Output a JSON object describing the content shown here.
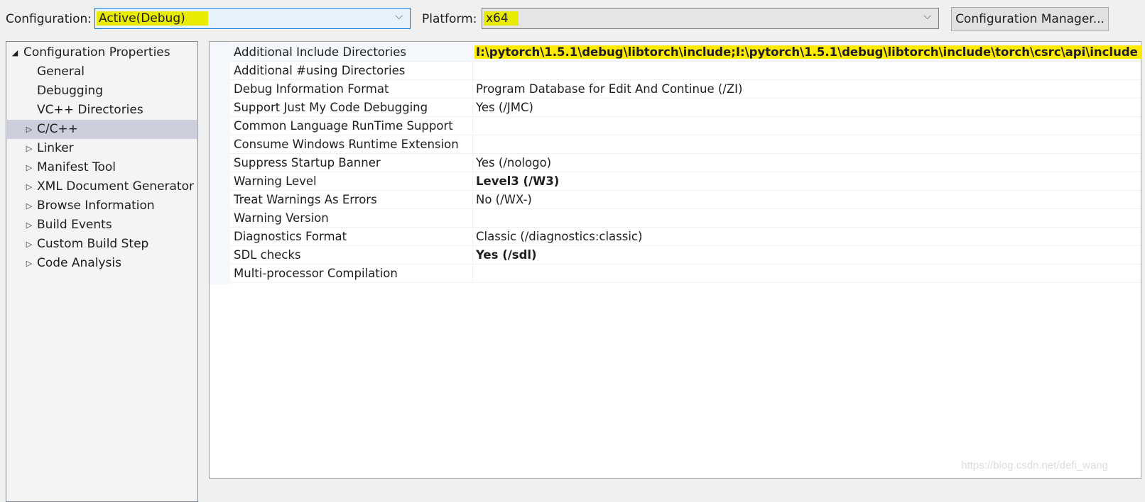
{
  "header": {
    "configuration_label": "Configuration:",
    "configuration_value": "Active(Debug)",
    "platform_label": "Platform:",
    "platform_value": "x64",
    "config_manager_button": "Configuration Manager...",
    "chevron_glyph": "⌵"
  },
  "tree": {
    "root": {
      "label": "Configuration Properties",
      "expanded": true,
      "arrow": "◢"
    },
    "items": [
      {
        "label": "General",
        "expandable": false
      },
      {
        "label": "Debugging",
        "expandable": false
      },
      {
        "label": "VC++ Directories",
        "expandable": false
      },
      {
        "label": "C/C++",
        "expandable": true,
        "selected": true
      },
      {
        "label": "Linker",
        "expandable": true
      },
      {
        "label": "Manifest Tool",
        "expandable": true
      },
      {
        "label": "XML Document Generator",
        "expandable": true
      },
      {
        "label": "Browse Information",
        "expandable": true
      },
      {
        "label": "Build Events",
        "expandable": true
      },
      {
        "label": "Custom Build Step",
        "expandable": true
      },
      {
        "label": "Code Analysis",
        "expandable": true
      }
    ],
    "collapsed_arrow": "▷"
  },
  "properties": [
    {
      "name": "Additional Include Directories",
      "value": "I:\\pytorch\\1.5.1\\debug\\libtorch\\include;I:\\pytorch\\1.5.1\\debug\\libtorch\\include\\torch\\csrc\\api\\include",
      "bold": true,
      "highlighted": true,
      "selected": true
    },
    {
      "name": "Additional #using Directories",
      "value": ""
    },
    {
      "name": "Debug Information Format",
      "value": "Program Database for Edit And Continue (/ZI)"
    },
    {
      "name": "Support Just My Code Debugging",
      "value": "Yes (/JMC)"
    },
    {
      "name": "Common Language RunTime Support",
      "value": ""
    },
    {
      "name": "Consume Windows Runtime Extension",
      "value": ""
    },
    {
      "name": "Suppress Startup Banner",
      "value": "Yes (/nologo)"
    },
    {
      "name": "Warning Level",
      "value": "Level3 (/W3)",
      "bold": true
    },
    {
      "name": "Treat Warnings As Errors",
      "value": "No (/WX-)"
    },
    {
      "name": "Warning Version",
      "value": ""
    },
    {
      "name": "Diagnostics Format",
      "value": "Classic (/diagnostics:classic)"
    },
    {
      "name": "SDL checks",
      "value": "Yes (/sdl)",
      "bold": true
    },
    {
      "name": "Multi-processor Compilation",
      "value": ""
    }
  ],
  "watermark": "https://blog.csdn.net/defi_wang",
  "colors": {
    "highlight": "#ffeb00",
    "tree_selected": "#cccedb",
    "active_combo_border": "#0078d7"
  }
}
